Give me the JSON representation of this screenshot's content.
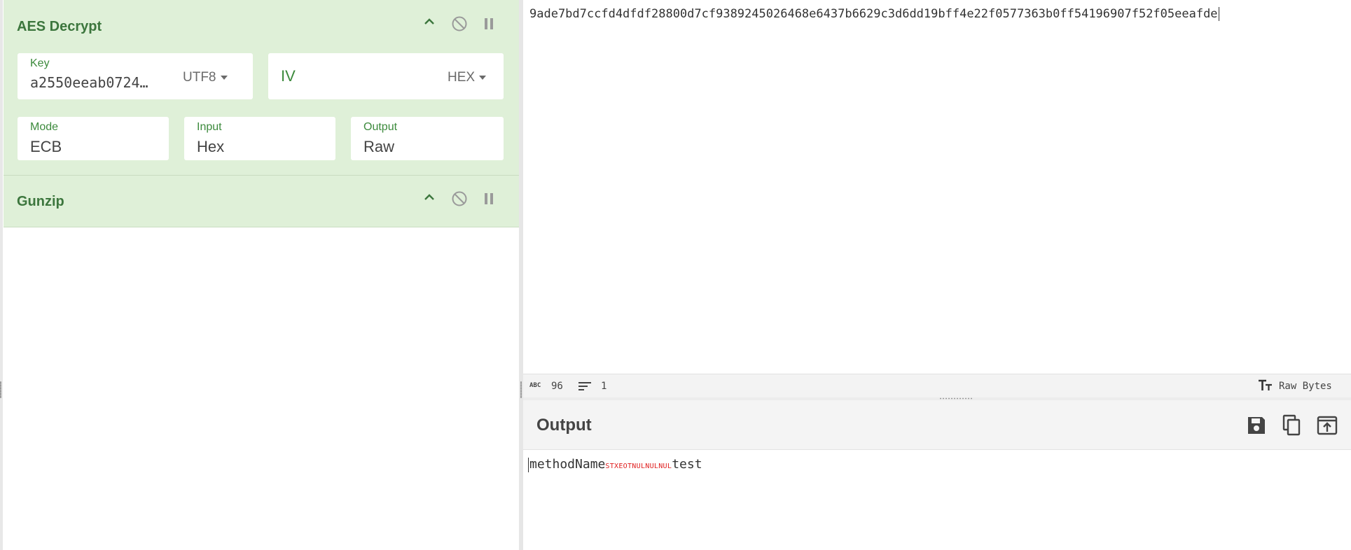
{
  "recipe": {
    "operations": [
      {
        "title": "AES Decrypt",
        "key": {
          "label": "Key",
          "value": "a2550eeab0724…",
          "encoding": "UTF8"
        },
        "iv": {
          "label": "IV",
          "value": "",
          "encoding": "HEX"
        },
        "mode": {
          "label": "Mode",
          "value": "ECB"
        },
        "input": {
          "label": "Input",
          "value": "Hex"
        },
        "output": {
          "label": "Output",
          "value": "Raw"
        }
      },
      {
        "title": "Gunzip"
      }
    ]
  },
  "input": {
    "text": "9ade7bd7ccfd4dfdf28800d7cf9389245026468e6437b6629c3d6dd19bff4e22f0577363b0ff54196907f52f05eeafde"
  },
  "status": {
    "length_icon_text": "ABC",
    "length": "96",
    "lines": "1",
    "encoding": "Raw Bytes"
  },
  "output": {
    "title": "Output",
    "text_before": "methodName",
    "control_chars": "STXEOTNULNULNUL",
    "text_after": "test"
  },
  "colors": {
    "op_background": "#dff0d8",
    "op_title": "#3c763d",
    "control_char": "#e02020"
  },
  "icons": [
    "chevron-up-icon",
    "disable-icon",
    "pause-icon",
    "text-size-icon",
    "save-icon",
    "copy-icon",
    "replace-input-icon"
  ]
}
